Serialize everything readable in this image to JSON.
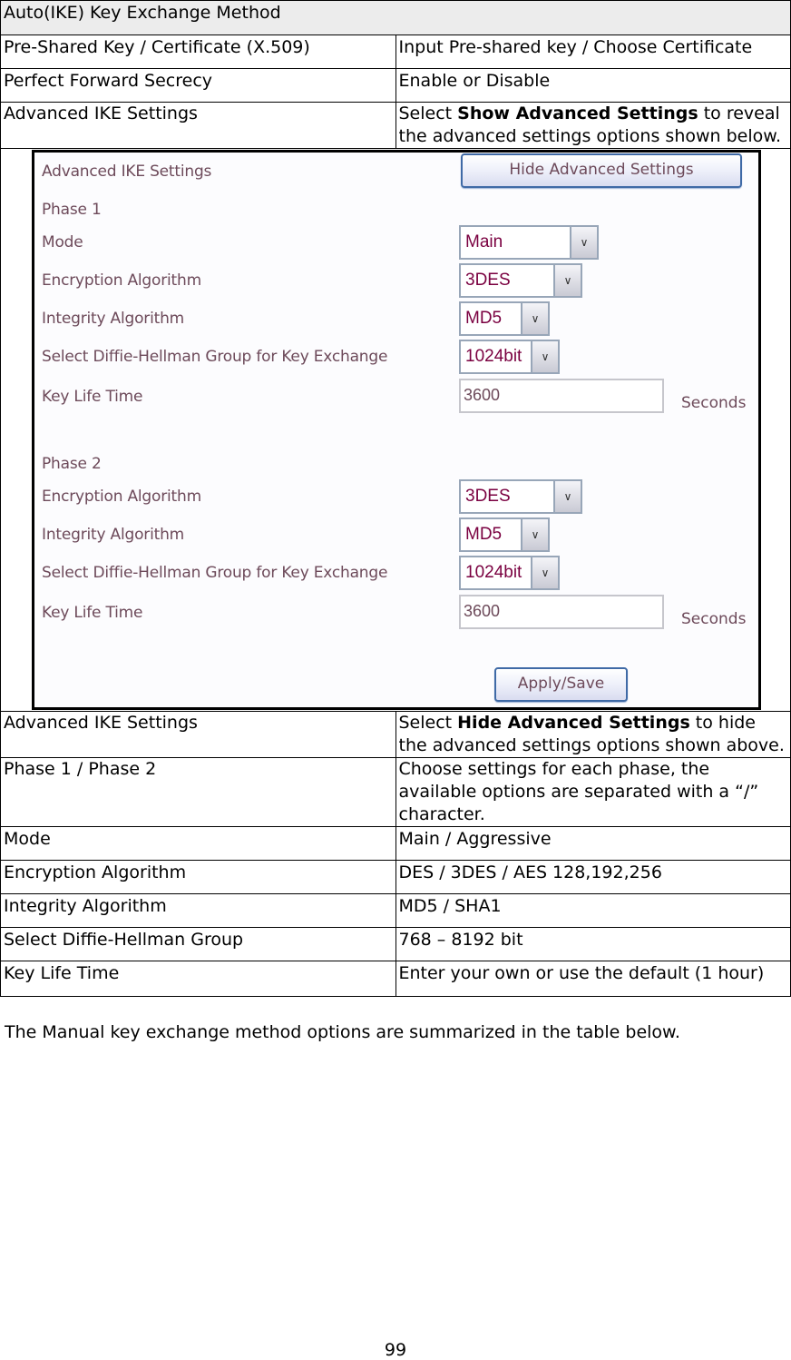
{
  "table_top": {
    "header": "Auto(IKE) Key Exchange Method",
    "rows": [
      {
        "label": "Pre-Shared Key / Certificate (X.509)",
        "value": "Input Pre-shared key / Choose Certificate"
      },
      {
        "label": "Perfect Forward Secrecy",
        "value": "Enable or Disable"
      },
      {
        "label": "Advanced IKE Settings",
        "value_prefix": "Select ",
        "value_bold": "Show Advanced Settings",
        "value_suffix": " to reveal the advanced settings options shown below."
      }
    ]
  },
  "screenshot": {
    "section_title": "Advanced IKE Settings",
    "hide_button": "Hide Advanced Settings",
    "phase1": {
      "title": "Phase 1",
      "mode_label": "Mode",
      "mode_value": "Main",
      "encryption_label": "Encryption Algorithm",
      "encryption_value": "3DES",
      "integrity_label": "Integrity Algorithm",
      "integrity_value": "MD5",
      "dh_label": "Select Diffie-Hellman Group for Key Exchange",
      "dh_value": "1024bit",
      "lifetime_label": "Key Life Time",
      "lifetime_value": "3600",
      "lifetime_units": "Seconds"
    },
    "phase2": {
      "title": "Phase 2",
      "encryption_label": "Encryption Algorithm",
      "encryption_value": "3DES",
      "integrity_label": "Integrity Algorithm",
      "integrity_value": "MD5",
      "dh_label": "Select Diffie-Hellman Group for Key Exchange",
      "dh_value": "1024bit",
      "lifetime_label": "Key Life Time",
      "lifetime_value": "3600",
      "lifetime_units": "Seconds"
    },
    "apply_button": "Apply/Save",
    "dropdown_arrow": "chevron-down"
  },
  "table_bottom": {
    "rows": [
      {
        "label": "Advanced IKE Settings",
        "value_prefix": "Select ",
        "value_bold": "Hide Advanced Settings",
        "value_suffix": " to hide the advanced settings options shown above."
      },
      {
        "label": "Phase 1 / Phase 2",
        "value": "Choose settings for each phase, the available options are separated with a “/” character."
      },
      {
        "label": "Mode",
        "value": "Main / Aggressive"
      },
      {
        "label": "Encryption Algorithm",
        "value": "DES / 3DES / AES 128,192,256"
      },
      {
        "label": "Integrity Algorithm",
        "value": "MD5 / SHA1"
      },
      {
        "label": "Select Diffie-Hellman Group",
        "value": "768 – 8192 bit"
      },
      {
        "label": "Key Life Time",
        "value": "Enter your own or use the default (1 hour)"
      }
    ]
  },
  "paragraph": "The Manual key exchange method options are summarized in the table below.",
  "page_number": "99"
}
